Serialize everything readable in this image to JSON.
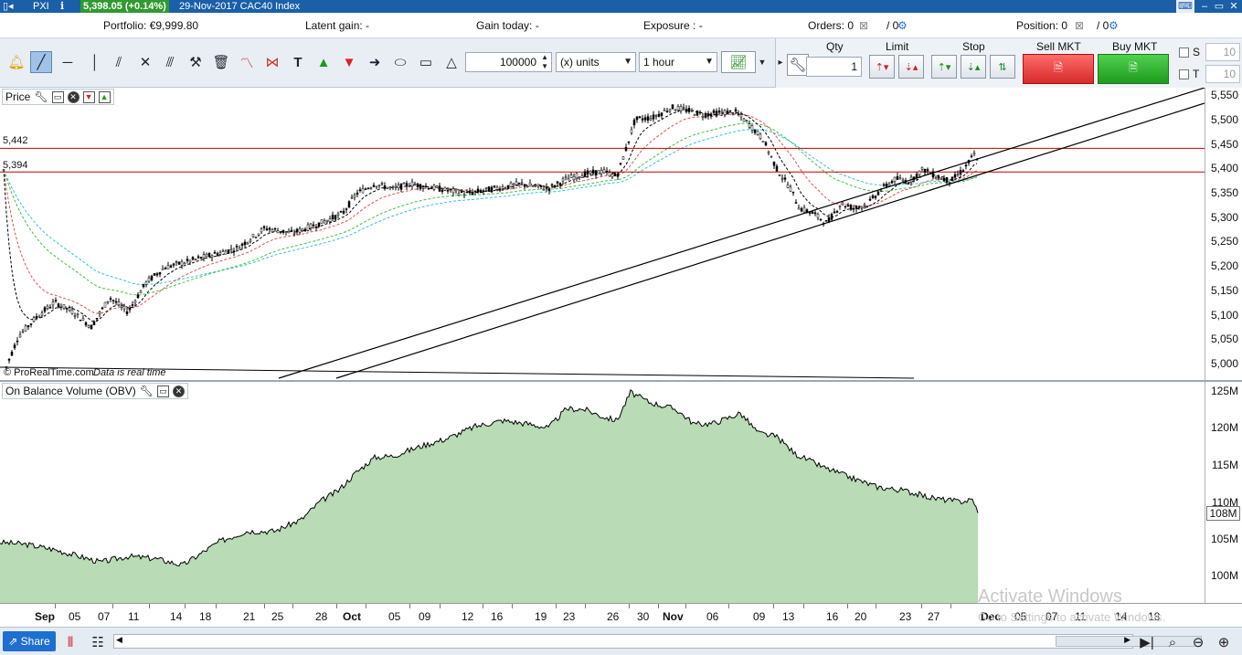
{
  "titlebar": {
    "app": "PXI",
    "price": "5,398.05 (+0.14%)",
    "date_instrument": "29-Nov-2017 CAC40 Index",
    "min": "–",
    "max": "▭",
    "close": "✕"
  },
  "info": {
    "portfolio": "Portfolio: €9,999.80",
    "latent": "Latent gain: -",
    "gain_today": "Gain today: -",
    "exposure": "Exposure : -",
    "orders": "Orders: 0",
    "orders_sub": "/ 0",
    "position": "Position: 0",
    "position_sub": "/ 0"
  },
  "toolbar": {
    "quantity": "100000",
    "units": "(x) units",
    "timeframe": "1 hour"
  },
  "order_panel": {
    "qty_label": "Qty",
    "qty_value": "1",
    "limit_label": "Limit",
    "stop_label": "Stop",
    "sell_label": "Sell MKT",
    "buy_label": "Buy MKT",
    "s_label": "S",
    "t_label": "T",
    "s_value": "10",
    "t_value": "10"
  },
  "price_panel": {
    "label": "Price",
    "level1": "5,442",
    "level2": "5,394",
    "copyright": "© ProRealTime.com",
    "realtime": "Data is real time",
    "yticks": [
      "5,550",
      "5,500",
      "5,450",
      "5,400",
      "5,350",
      "5,300",
      "5,250",
      "5,200",
      "5,150",
      "5,100",
      "5,050",
      "5,000"
    ]
  },
  "obv_panel": {
    "label": "On Balance Volume (OBV)",
    "yticks": [
      "125M",
      "120M",
      "115M",
      "110M",
      "105M",
      "100M"
    ],
    "current": "108M"
  },
  "xaxis": {
    "labels": [
      "Sep",
      "05",
      "07",
      "11",
      "14",
      "18",
      "21",
      "25",
      "28",
      "Oct",
      "05",
      "09",
      "12",
      "16",
      "19",
      "23",
      "26",
      "30",
      "Nov",
      "06",
      "09",
      "13",
      "16",
      "20",
      "23",
      "27",
      "Dec",
      "05",
      "07",
      "11",
      "14",
      "18"
    ]
  },
  "watermark": {
    "line1": "Activate Windows",
    "line2": "Go to Settings to activate Windows."
  },
  "bottombar": {
    "share": "Share"
  },
  "colors": {
    "level_line": "#c00000",
    "ema_fast": "#000000",
    "ema_mid": "#e05050",
    "ema_slow": "#40c040",
    "ema_slowest": "#30c0e0",
    "obv_fill": "#b9dbb6"
  }
}
